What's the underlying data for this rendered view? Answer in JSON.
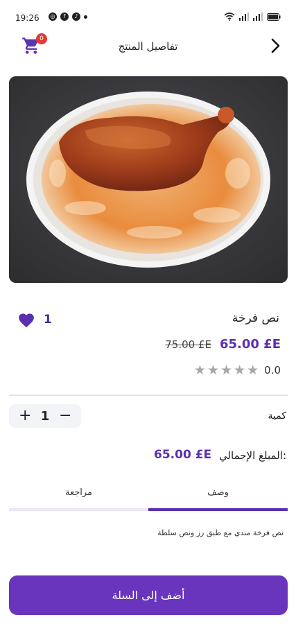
{
  "status_bar": {
    "time": "19:26",
    "notification_icons": [
      "whatsapp-icon",
      "facebook-icon",
      "tiktok-icon",
      "dot-icon"
    ],
    "system_icons": [
      "wifi-icon",
      "signal-icon",
      "signal-icon",
      "battery-icon"
    ]
  },
  "header": {
    "title": "تفاصيل المنتج",
    "cart_count": "0"
  },
  "product": {
    "name": "نص فرخة",
    "price": "65.00 £E",
    "old_price": "75.00 £E",
    "rating": "0.0",
    "stars_filled": 0,
    "stars_total": 5,
    "favorite_count": "1",
    "carousel_active": 1,
    "carousel_total": 1
  },
  "quantity": {
    "label": "كمية",
    "value": "1",
    "plus": "+",
    "minus": "−"
  },
  "total": {
    "label": "المبلغ الإجمالي:",
    "value": "65.00 £E"
  },
  "tabs": {
    "description": "وصف",
    "review": "مراجعة",
    "active": "description"
  },
  "description_text": "نص فرخة مندي مع طبق رز ونص سلطة",
  "add_to_cart_label": "أضف إلى السلة",
  "colors": {
    "accent": "#6a35bd",
    "price": "#5b2fb0",
    "badge": "#e53935",
    "star_empty": "#a7a7a7"
  }
}
